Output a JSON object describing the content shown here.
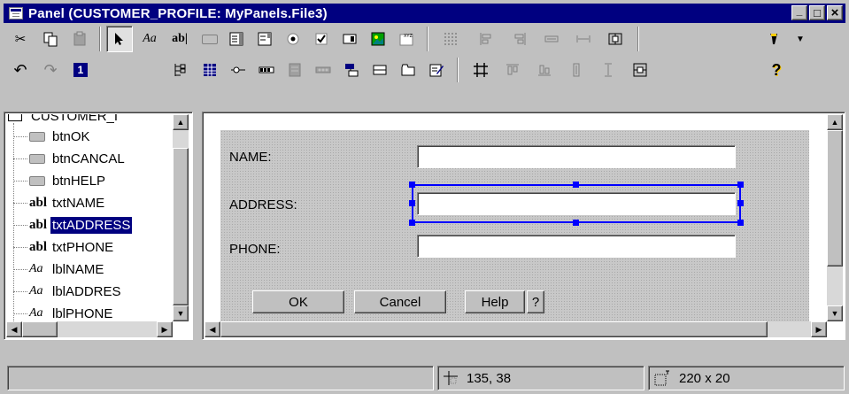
{
  "window": {
    "title": "Panel (CUSTOMER_PROFILE: MyPanels.File3)",
    "controls": [
      "_",
      "□",
      "×"
    ]
  },
  "toolbar": {
    "row1_icons": [
      "cut-icon",
      "copy-icon",
      "paste-icon",
      "pointer-icon",
      "label-tool-icon",
      "text-field-tool-icon",
      "button-tool-icon",
      "list-tool-icon",
      "combo-tool-icon",
      "radio-tool-icon",
      "checkbox-tool-icon",
      "groupbox-tool-icon",
      "image-tool-icon",
      "graphic-tool-icon",
      "grid-icon",
      "align-left-icon",
      "align-right-icon",
      "same-width-icon",
      "spacing-icon",
      "center-horizontal-icon",
      "flashlight-icon",
      "dropdown-arrow-icon"
    ],
    "row2_icons": [
      "undo-icon",
      "redo-icon",
      "help-number-icon",
      "tree-tool-icon",
      "table-tool-icon",
      "slider-tool-icon",
      "progress-tool-icon",
      "scroll-tool-icon",
      "spinner-tool-icon",
      "menu-tool-icon",
      "status-tool-icon",
      "tab-tool-icon",
      "editor-tool-icon",
      "crop-icon",
      "align-top-icon",
      "align-bottom-icon",
      "same-height-icon",
      "distribute-icon",
      "center-vertical-icon",
      "context-help-icon"
    ],
    "help_number": "1",
    "context_help": "?"
  },
  "tree": {
    "root_label": "CUSTOMER_I",
    "items": [
      {
        "type": "button",
        "label": "btnOK"
      },
      {
        "type": "button",
        "label": "btnCANCAL"
      },
      {
        "type": "button",
        "label": "btnHELP"
      },
      {
        "type": "text",
        "label": "txtNAME"
      },
      {
        "type": "text",
        "label": "txtADDRESS"
      },
      {
        "type": "text",
        "label": "txtPHONE"
      },
      {
        "type": "label",
        "label": "lblNAME"
      },
      {
        "type": "label",
        "label": "lblADDRES"
      },
      {
        "type": "label",
        "label": "lblPHONE"
      }
    ],
    "selected_index": 4,
    "text_icon_glyph": "abl",
    "label_icon_glyph": "Aa"
  },
  "panel": {
    "labels": {
      "name": "NAME:",
      "address": "ADDRESS:",
      "phone": "PHONE:"
    },
    "fields": {
      "name": "",
      "address": "",
      "phone": ""
    },
    "buttons": {
      "ok": "OK",
      "cancel": "Cancel",
      "help": "Help",
      "question": "?"
    }
  },
  "status": {
    "position": "135, 38",
    "size": "220 x 20"
  },
  "colors": {
    "title_bar": "#000080",
    "selection": "#000080",
    "handles": "#0000ff",
    "face": "#c0c0c0"
  }
}
